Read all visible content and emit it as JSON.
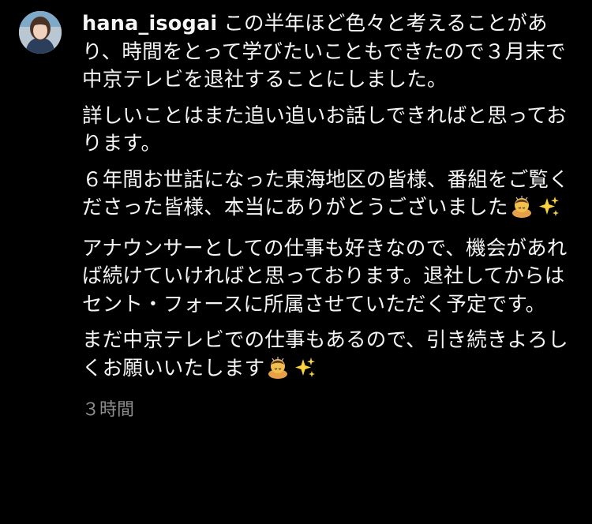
{
  "comment": {
    "username": "hana_isogai",
    "paragraphs": [
      "この半年ほど色々と考えることがあり、時間をとって学びたいこともできたので３月末で中京テレビを退社することにしました。",
      "詳しいことはまた追い追いお話しできればと思っております。",
      "６年間お世話になった東海地区の皆様、番組をご覧くださった皆様、本当にありがとうございました",
      "アナウンサーとしての仕事も好きなので、機会があれば続けていければと思っております。退社してからはセント・フォースに所属させていただく予定です。",
      "まだ中京テレビでの仕事もあるので、引き続きよろしくお願いいたします"
    ],
    "emojis": [
      "bowing-person-emoji",
      "sparkles-emoji"
    ],
    "timestamp": "３時間"
  }
}
